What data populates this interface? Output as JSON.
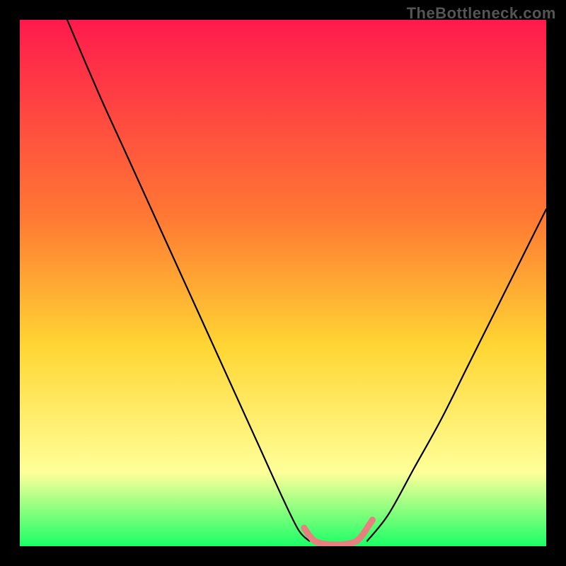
{
  "watermark": "TheBottleneck.com",
  "chart_data": {
    "type": "line",
    "title": "",
    "xlabel": "",
    "ylabel": "",
    "xlim": [
      0,
      100
    ],
    "ylim": [
      0,
      100
    ],
    "grid": false,
    "legend": false,
    "background": {
      "top_color": "#ff1a4d",
      "upper_mid_color": "#ff7a33",
      "mid_color": "#ffd633",
      "lower_mid_color": "#ffff99",
      "bottom_color": "#1aff66"
    },
    "series": [
      {
        "name": "bottleneck-left-curve",
        "color": "#000000",
        "weight": 2,
        "x": [
          9,
          15,
          20,
          25,
          30,
          35,
          40,
          45,
          50,
          53,
          55
        ],
        "y": [
          100,
          86,
          75,
          64,
          53,
          42,
          31,
          20,
          9,
          3,
          1
        ]
      },
      {
        "name": "bottleneck-right-curve",
        "color": "#000000",
        "weight": 2,
        "x": [
          66,
          70,
          75,
          80,
          85,
          90,
          95,
          100
        ],
        "y": [
          1,
          6,
          15,
          24,
          34,
          44,
          54,
          64
        ]
      },
      {
        "name": "optimal-zone-highlight",
        "color": "#e98080",
        "weight": 9,
        "x": [
          54,
          55,
          56,
          57,
          58,
          59,
          60,
          61,
          62,
          63,
          64,
          65,
          66,
          67
        ],
        "y": [
          3.5,
          2,
          1,
          0.6,
          0.4,
          0.3,
          0.3,
          0.3,
          0.4,
          0.6,
          1,
          2,
          3.5,
          5
        ]
      }
    ]
  }
}
